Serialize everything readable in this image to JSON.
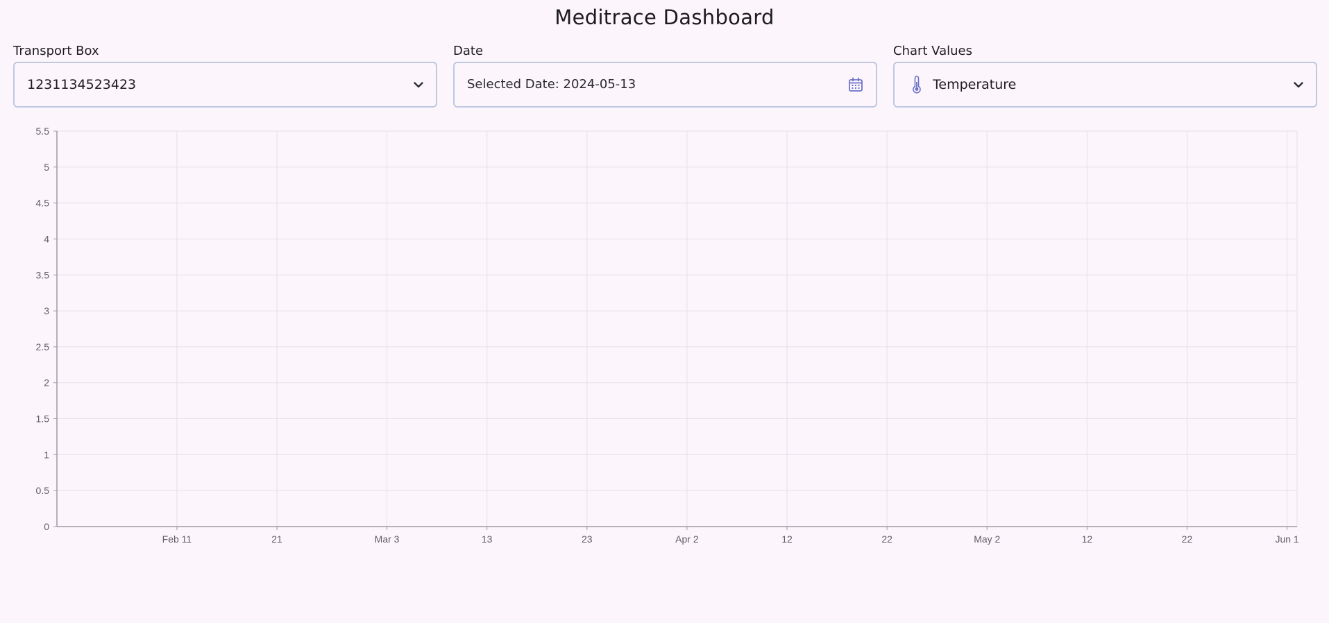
{
  "header": {
    "title": "Meditrace Dashboard"
  },
  "transport_box": {
    "label": "Transport Box",
    "value": "1231134523423",
    "icon": "chevron-down-icon"
  },
  "date": {
    "label": "Date",
    "value": "Selected Date: 2024-05-13",
    "icon": "calendar-icon"
  },
  "chart_values": {
    "label": "Chart Values",
    "value": "Temperature",
    "icon": "thermometer-icon",
    "icon_color": "#6b72c9"
  },
  "colors": {
    "background": "#fcf5fc",
    "field_border": "#bfc8e0",
    "grid": "#e4e0e6",
    "axis": "#9e9aa2"
  },
  "chart_data": {
    "type": "line",
    "title": "",
    "xlabel": "",
    "ylabel": "",
    "series": [],
    "x_range": [
      "2024-01-30",
      "2024-06-02"
    ],
    "ylim": [
      0,
      5.5
    ],
    "y_ticks": [
      0,
      0.5,
      1,
      1.5,
      2,
      2.5,
      3,
      3.5,
      4,
      4.5,
      5,
      5.5
    ],
    "y_tick_labels": [
      "0",
      "0.5",
      "1",
      "1.5",
      "2",
      "2.5",
      "3",
      "3.5",
      "4",
      "4.5",
      "5",
      "5.5"
    ],
    "x_ticks": [
      "2024-02-11",
      "2024-02-21",
      "2024-03-03",
      "2024-03-13",
      "2024-03-23",
      "2024-04-02",
      "2024-04-12",
      "2024-04-22",
      "2024-05-02",
      "2024-05-12",
      "2024-05-22",
      "2024-06-01"
    ],
    "x_tick_labels": [
      "Feb 11",
      "21",
      "Mar 3",
      "13",
      "23",
      "Apr 2",
      "12",
      "22",
      "May 2",
      "12",
      "22",
      "Jun 1"
    ],
    "grid": true
  }
}
